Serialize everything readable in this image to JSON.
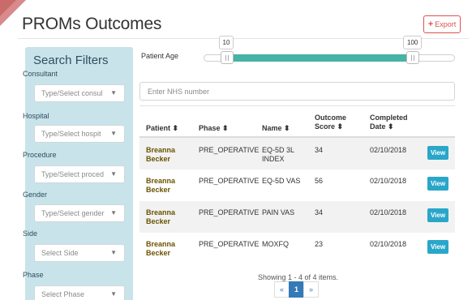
{
  "page": {
    "title": "PROMs Outcomes",
    "export_label": "Export"
  },
  "sidebar": {
    "title": "Search Filters",
    "filters": [
      {
        "label": "Consultant",
        "placeholder": "Type/Select consul"
      },
      {
        "label": "Hospital",
        "placeholder": "Type/Select hospit"
      },
      {
        "label": "Procedure",
        "placeholder": "Type/Select proced"
      },
      {
        "label": "Gender",
        "placeholder": "Type/Select gender"
      },
      {
        "label": "Side",
        "placeholder": "Select Side"
      },
      {
        "label": "Phase",
        "placeholder": "Select Phase"
      }
    ]
  },
  "age_filter": {
    "label": "Patient Age",
    "min_value": "10",
    "max_value": "100",
    "range": [
      0,
      120
    ]
  },
  "nhs": {
    "placeholder": "Enter NHS number"
  },
  "table": {
    "columns": [
      {
        "line1": "Patient ⬍",
        "line2": ""
      },
      {
        "line1": "Phase ⬍",
        "line2": ""
      },
      {
        "line1": "Name ⬍",
        "line2": ""
      },
      {
        "line1": "Outcome",
        "line2": "Score ⬍"
      },
      {
        "line1": "Completed",
        "line2": "Date ⬍"
      }
    ],
    "rows": [
      {
        "patient_first": "Breanna",
        "patient_last": "Becker",
        "phase": "PRE_OPERATIVE",
        "name_line1": "EQ-5D 3L",
        "name_line2": "INDEX",
        "score": "34",
        "date": "02/10/2018",
        "action": "View"
      },
      {
        "patient_first": "Breanna",
        "patient_last": "Becker",
        "phase": "PRE_OPERATIVE",
        "name_line1": "EQ-5D VAS",
        "name_line2": "",
        "score": "56",
        "date": "02/10/2018",
        "action": "View"
      },
      {
        "patient_first": "Breanna",
        "patient_last": "Becker",
        "phase": "PRE_OPERATIVE",
        "name_line1": "PAIN VAS",
        "name_line2": "",
        "score": "34",
        "date": "02/10/2018",
        "action": "View"
      },
      {
        "patient_first": "Breanna",
        "patient_last": "Becker",
        "phase": "PRE_OPERATIVE",
        "name_line1": "MOXFQ",
        "name_line2": "",
        "score": "23",
        "date": "02/10/2018",
        "action": "View"
      }
    ]
  },
  "pagination": {
    "summary": "Showing 1 - 4 of 4 items.",
    "prev": "«",
    "current": "1",
    "next": "»"
  },
  "colors": {
    "accent_teal": "#45b3a5",
    "sidebar_bg": "#c9e3ea",
    "export_red": "#d9534f",
    "view_blue": "#2aa6c9",
    "patient_gold": "#6b5300"
  }
}
